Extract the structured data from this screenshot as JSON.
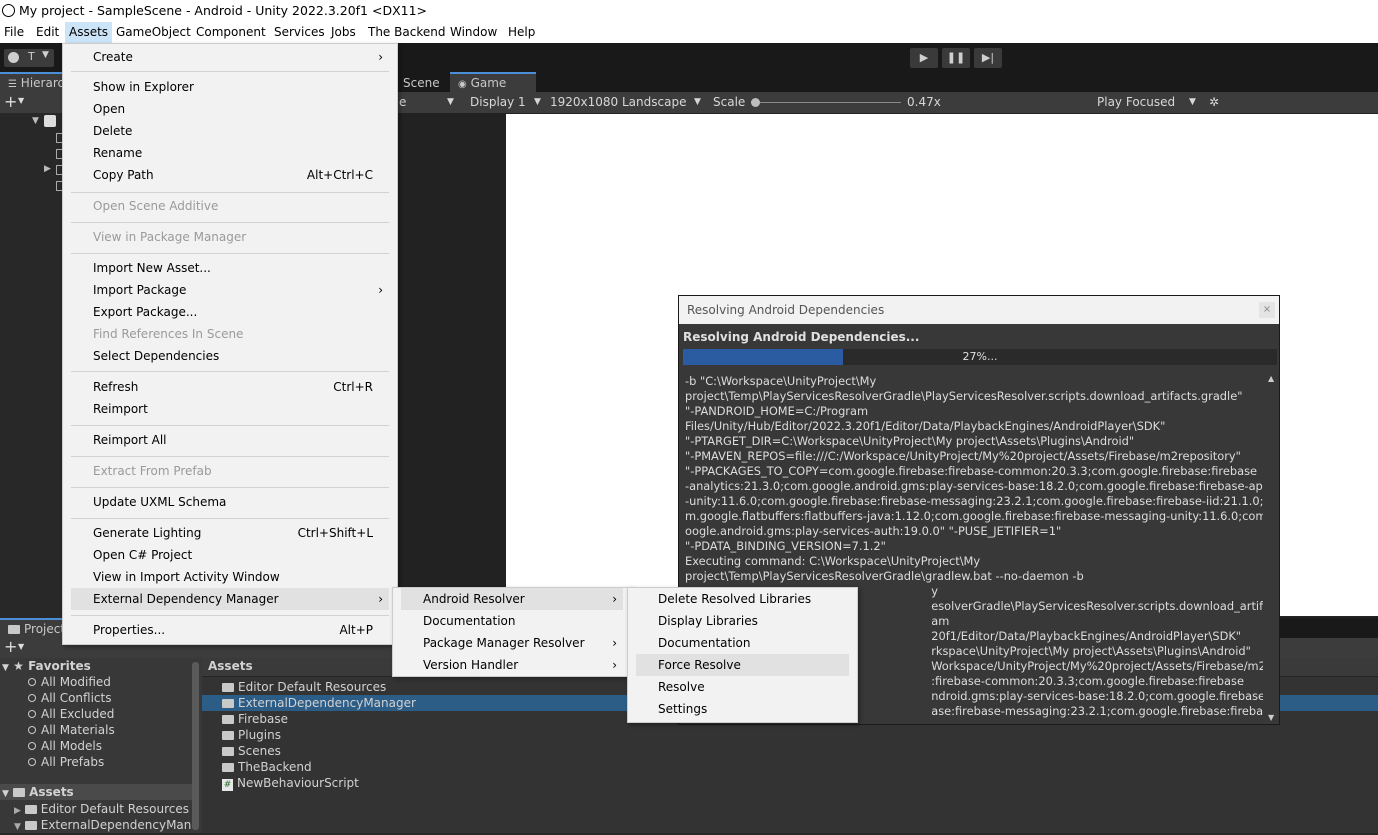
{
  "window": {
    "title": "My project - SampleScene - Android - Unity 2022.3.20f1 <DX11>"
  },
  "menubar": [
    "File",
    "Edit",
    "Assets",
    "GameObject",
    "Component",
    "Services",
    "Jobs",
    "The Backend",
    "Window",
    "Help"
  ],
  "toolbar": {
    "account_label": "T"
  },
  "hierarchy": {
    "tab": "Hierarch"
  },
  "game": {
    "scene_tab": "Scene",
    "game_tab": "Game",
    "display": "Display 1",
    "resolution": "1920x1080 Landscape",
    "scale_label": "Scale",
    "scale_value": "0.47x",
    "play_mode": "Play Focused",
    "shown_fragment": "e"
  },
  "assets_menu": {
    "items": [
      {
        "label": "Create",
        "arrow": true
      },
      {
        "label": "Show in Explorer"
      },
      {
        "label": "Open"
      },
      {
        "label": "Delete"
      },
      {
        "label": "Rename"
      },
      {
        "label": "Copy Path",
        "shortcut": "Alt+Ctrl+C"
      },
      {
        "label": "Open Scene Additive",
        "disabled": true
      },
      {
        "label": "View in Package Manager",
        "disabled": true
      },
      {
        "label": "Import New Asset..."
      },
      {
        "label": "Import Package",
        "arrow": true
      },
      {
        "label": "Export Package..."
      },
      {
        "label": "Find References In Scene",
        "disabled": true
      },
      {
        "label": "Select Dependencies"
      },
      {
        "label": "Refresh",
        "shortcut": "Ctrl+R"
      },
      {
        "label": "Reimport"
      },
      {
        "label": "Reimport All"
      },
      {
        "label": "Extract From Prefab",
        "disabled": true
      },
      {
        "label": "Update UXML Schema"
      },
      {
        "label": "Generate Lighting",
        "shortcut": "Ctrl+Shift+L"
      },
      {
        "label": "Open C# Project"
      },
      {
        "label": "View in Import Activity Window"
      },
      {
        "label": "External Dependency Manager",
        "arrow": true,
        "highlight": true
      },
      {
        "label": "Properties...",
        "shortcut": "Alt+P"
      }
    ]
  },
  "edm_menu": {
    "items": [
      {
        "label": "Android Resolver",
        "arrow": true,
        "highlight": true
      },
      {
        "label": "Documentation"
      },
      {
        "label": "Package Manager Resolver",
        "arrow": true
      },
      {
        "label": "Version Handler",
        "arrow": true
      }
    ]
  },
  "android_menu": {
    "items": [
      {
        "label": "Delete Resolved Libraries"
      },
      {
        "label": "Display Libraries"
      },
      {
        "label": "Documentation"
      },
      {
        "label": "Force Resolve",
        "highlight": true
      },
      {
        "label": "Resolve"
      },
      {
        "label": "Settings"
      }
    ]
  },
  "dialog": {
    "title": "Resolving Android Dependencies",
    "close": "×",
    "heading": "Resolving Android Dependencies...",
    "progress": 0.27,
    "progress_label": "27%...",
    "log_lines": [
      "-b \"C:\\Workspace\\UnityProject\\My",
      "project\\Temp\\PlayServicesResolverGradle\\PlayServicesResolver.scripts.download_artifacts.gradle\"",
      "\"-PANDROID_HOME=C:/Program",
      "Files/Unity/Hub/Editor/2022.3.20f1/Editor/Data/PlaybackEngines/AndroidPlayer\\SDK\"",
      "\"-PTARGET_DIR=C:\\Workspace\\UnityProject\\My project\\Assets\\Plugins\\Android\"",
      "\"-PMAVEN_REPOS=file:///C:/Workspace/UnityProject/My%20project/Assets/Firebase/m2repository\"",
      "\"-PPACKAGES_TO_COPY=com.google.firebase:firebase-common:20.3.3;com.google.firebase:firebase",
      "-analytics:21.3.0;com.google.android.gms:play-services-base:18.2.0;com.google.firebase:firebase-app",
      "-unity:11.6.0;com.google.firebase:firebase-messaging:23.2.1;com.google.firebase:firebase-iid:21.1.0;co",
      "m.google.flatbuffers:flatbuffers-java:1.12.0;com.google.firebase:firebase-messaging-unity:11.6.0;com.g",
      "oogle.android.gms:play-services-auth:19.0.0\" \"-PUSE_JETIFIER=1\"",
      "\"-PDATA_BINDING_VERSION=7.1.2\"",
      "Executing command: C:\\Workspace\\UnityProject\\My",
      "project\\Temp\\PlayServicesResolverGradle\\gradlew.bat --no-daemon -b",
      "                                                                    y",
      "                                                                    esolverGradle\\PlayServicesResolver.scripts.download_artifacts.gradle\"",
      "                                                                    am",
      "                                                                    20f1/Editor/Data/PlaybackEngines/AndroidPlayer\\SDK\"",
      "                                                                    rkspace\\UnityProject\\My project\\Assets\\Plugins\\Android\"",
      "                                                                    Workspace/UnityProject/My%20project/Assets/Firebase/m2repository\"",
      "                                                                    :firebase-common:20.3.3;com.google.firebase:firebase",
      "                                                                    ndroid.gms:play-services-base:18.2.0;com.google.firebase:firebase-app",
      "                                                                    ase:firebase-messaging:23.2.1;com.google.firebase:firebase-iid:21.1.0;co"
    ]
  },
  "project": {
    "tab": "Project",
    "favorites_label": "Favorites",
    "favorites": [
      "All Modified",
      "All Conflicts",
      "All Excluded",
      "All Materials",
      "All Models",
      "All Prefabs"
    ],
    "assets_label": "Assets",
    "tree": [
      "Editor Default Resources",
      "ExternalDependencyMana"
    ],
    "breadcrumb": "Assets",
    "files": [
      {
        "name": "Editor Default Resources",
        "kind": "folder"
      },
      {
        "name": "ExternalDependencyManager",
        "kind": "folder",
        "selected": true
      },
      {
        "name": "Firebase",
        "kind": "folder"
      },
      {
        "name": "Plugins",
        "kind": "folder"
      },
      {
        "name": "Scenes",
        "kind": "folder"
      },
      {
        "name": "TheBackend",
        "kind": "folder"
      },
      {
        "name": "NewBehaviourScript",
        "kind": "script"
      }
    ]
  },
  "colors": {
    "accent": "#2b5ba0",
    "selection": "#2c5d87",
    "menu_bg": "#f2f2f2"
  }
}
